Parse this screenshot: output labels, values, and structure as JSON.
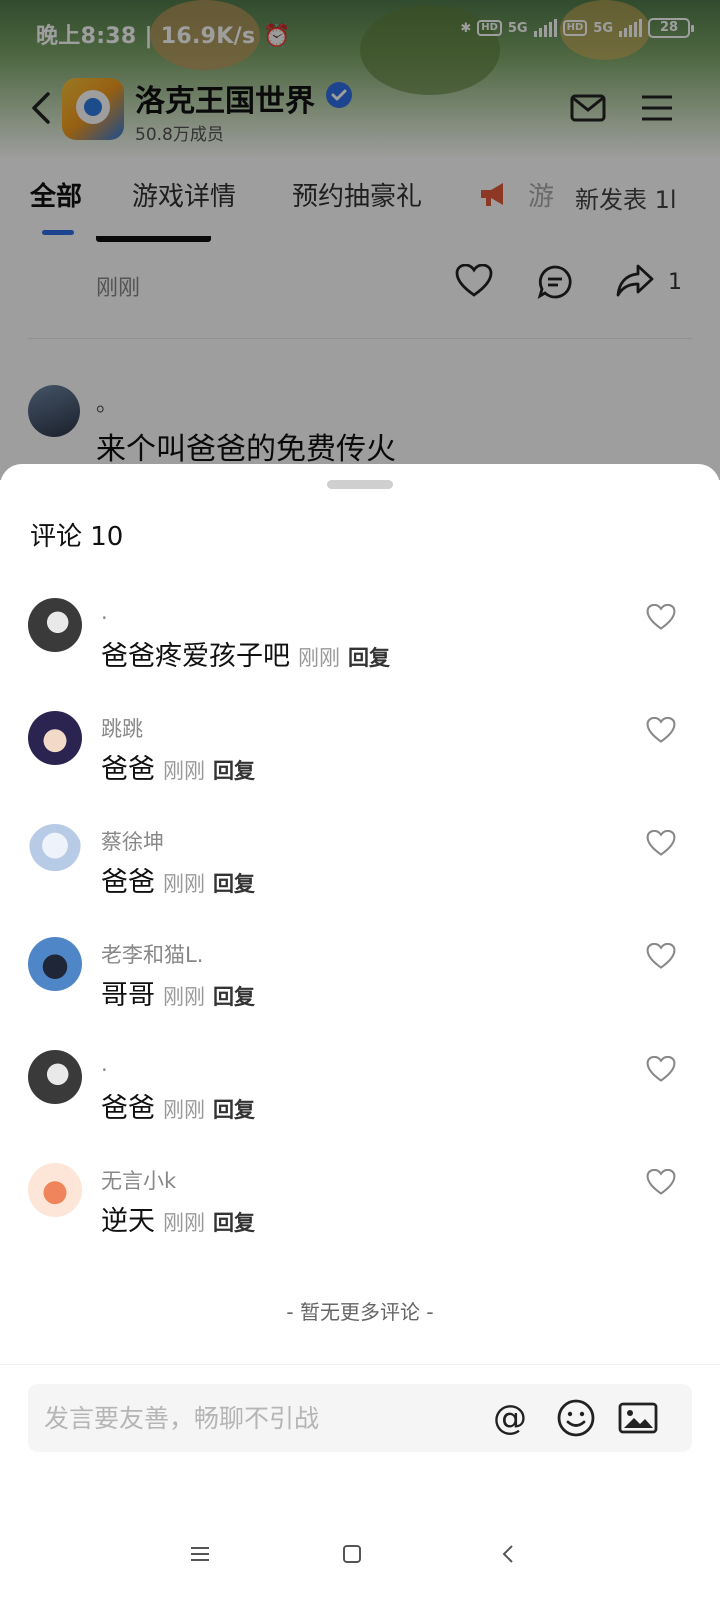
{
  "status_bar": {
    "time": "晚上8:38",
    "net_speed": "| 16.9K/s",
    "hd_label": "HD",
    "network_label": "5G",
    "battery": "28"
  },
  "header": {
    "group_name": "洛克王国世界",
    "members": "50.8万成员"
  },
  "tabs": [
    {
      "label": "全部",
      "active": true
    },
    {
      "label": "游戏详情"
    },
    {
      "label": "预约抽豪礼"
    },
    {
      "label": "游"
    },
    {
      "label": "新发表 1l"
    }
  ],
  "background_post": {
    "time": "刚刚",
    "share_count": "1",
    "author": "。",
    "text": "来个叫爸爸的免费传火"
  },
  "comments_sheet": {
    "title": "评论 10",
    "reply_label": "回复",
    "no_more": "- 暂无更多评论 -",
    "comments": [
      {
        "name": ".",
        "text": "爸爸疼爱孩子吧",
        "time": "刚刚",
        "avatar": "dark"
      },
      {
        "name": "跳跳",
        "text": "爸爸",
        "time": "刚刚",
        "avatar": "anime"
      },
      {
        "name": "蔡徐坤",
        "text": "爸爸",
        "time": "刚刚",
        "avatar": "white"
      },
      {
        "name": "老李和猫L.",
        "text": "哥哥",
        "time": "刚刚",
        "avatar": "blue"
      },
      {
        "name": ".",
        "text": "爸爸",
        "time": "刚刚",
        "avatar": "dark"
      },
      {
        "name": "无言小k",
        "text": "逆天",
        "time": "刚刚",
        "avatar": "fox"
      }
    ]
  },
  "input": {
    "placeholder": "发言要友善，畅聊不引战"
  },
  "icons": {
    "at": "@"
  },
  "colors": {
    "accent": "#2f6fe6",
    "muted": "#999999"
  }
}
